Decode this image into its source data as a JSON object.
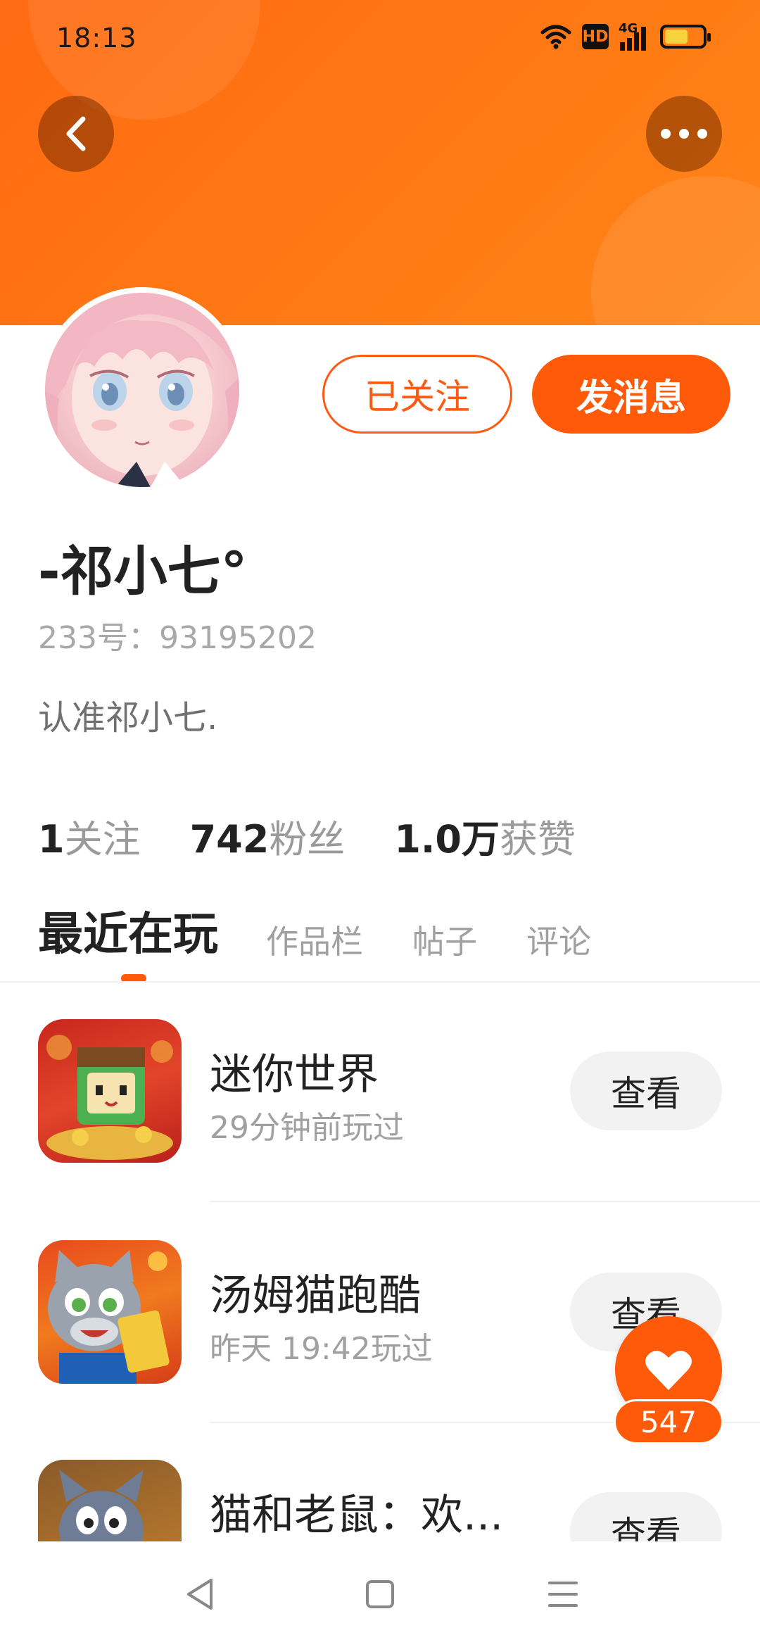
{
  "status_bar": {
    "time": "18:13",
    "icons": [
      "wifi-icon",
      "hd-icon",
      "signal-4g-icon",
      "battery-icon"
    ],
    "hd_label": "HD",
    "network_label": "4G"
  },
  "colors": {
    "accent": "#ff5a0a",
    "banner_start": "#ff6a12",
    "banner_end": "#ff861a",
    "muted_text": "#a0a0a0"
  },
  "profile": {
    "nickname": "-祁小七°",
    "uid": "233号：93195202",
    "bio": "认准祁小七."
  },
  "actions": {
    "follow_label": "已关注",
    "message_label": "发消息"
  },
  "stats": [
    {
      "value": "1",
      "label": "关注"
    },
    {
      "value": "742",
      "label": "粉丝"
    },
    {
      "value": "1.0万",
      "label": "获赞"
    }
  ],
  "tabs": [
    {
      "label": "最近在玩",
      "active": true
    },
    {
      "label": "作品栏",
      "active": false
    },
    {
      "label": "帖子",
      "active": false
    },
    {
      "label": "评论",
      "active": false
    }
  ],
  "games": [
    {
      "title": "迷你世界",
      "subtitle": "29分钟前玩过",
      "button": "查看"
    },
    {
      "title": "汤姆猫跑酷",
      "subtitle": "昨天 19:42玩过",
      "button": "查看"
    },
    {
      "title": "猫和老鼠：欢...",
      "subtitle": "",
      "button": "查看"
    }
  ],
  "like": {
    "count": "547"
  }
}
